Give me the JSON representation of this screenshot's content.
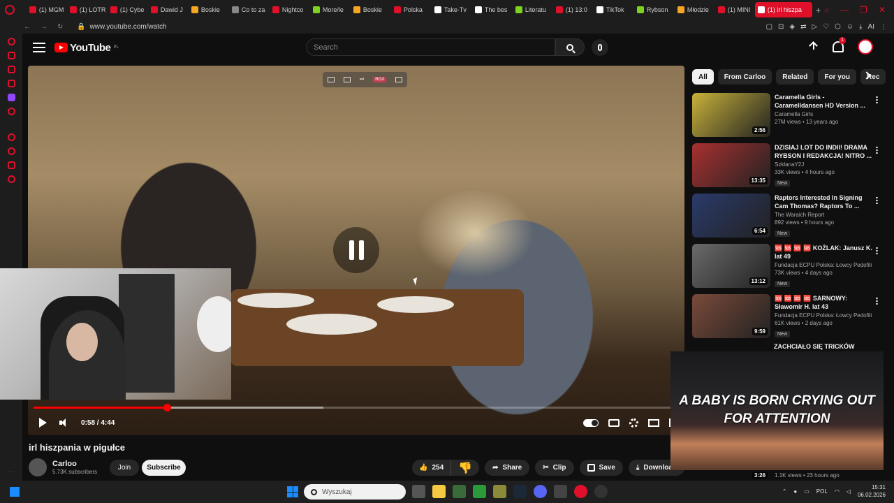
{
  "browser": {
    "tabs": [
      {
        "label": "(1) MGM",
        "color": "#e0102a"
      },
      {
        "label": "(1) LOTR",
        "color": "#e0102a"
      },
      {
        "label": "(1) Cybe",
        "color": "#e0102a"
      },
      {
        "label": "Dawid J",
        "color": "#e0102a"
      },
      {
        "label": "Boskie",
        "color": "#f5a623"
      },
      {
        "label": "Co to za",
        "color": "#888888"
      },
      {
        "label": "Nightco",
        "color": "#e0102a"
      },
      {
        "label": "More/le",
        "color": "#7ed321"
      },
      {
        "label": "Boskie",
        "color": "#f5a623"
      },
      {
        "label": "Polska",
        "color": "#e0102a"
      },
      {
        "label": "Take-Tv",
        "color": "#ffffff"
      },
      {
        "label": "The bes",
        "color": "#ffffff"
      },
      {
        "label": "Literatu",
        "color": "#7ed321"
      },
      {
        "label": "(1) 13:0",
        "color": "#e0102a"
      },
      {
        "label": "TikTok",
        "color": "#ffffff"
      },
      {
        "label": "Rybson",
        "color": "#7ed321"
      },
      {
        "label": "Młodzie",
        "color": "#f5a623"
      },
      {
        "label": "(1) MINI",
        "color": "#e0102a"
      }
    ],
    "active_tab": "(1) irl hiszpa",
    "new_tab": "+",
    "url": "www.youtube.com/watch"
  },
  "youtube": {
    "logo_text": "YouTube",
    "logo_region": "PL",
    "search_placeholder": "Search",
    "notification_count": "1"
  },
  "player": {
    "current_time": "0:58",
    "duration": "4:44",
    "time_display": "0:58 / 4:44",
    "played_fraction": 0.207,
    "loaded_fraction": 0.45,
    "overlay_label": "RGX"
  },
  "video": {
    "title": "irl hiszpania w pigułce",
    "channel_name": "Carloo",
    "subscribers": "5.73K subscribers",
    "join_label": "Join",
    "subscribe_label": "Subscribe",
    "likes": "254",
    "share_label": "Share",
    "clip_label": "Clip",
    "save_label": "Save",
    "download_label": "Download"
  },
  "filters": [
    "All",
    "From Carloo",
    "Related",
    "For you",
    "Rec"
  ],
  "recommendations": [
    {
      "title": "Caramella Girls - Caramelldansen HD Version ...",
      "channel": "Caramella Girls",
      "meta": "27M views • 13 years ago",
      "duration": "2:56",
      "new": "",
      "thumb_color": "#c8b23a"
    },
    {
      "title": "DZISIAJ LOT DO INDII! DRAMA RYBSON I REDAKCJA! NITRO ...",
      "channel": "SzklanaY2J",
      "meta": "33K views • 4 hours ago",
      "duration": "13:35",
      "new": "New",
      "thumb_color": "#a83030"
    },
    {
      "title": "Raptors Interested In Signing Cam Thomas? Raptors To ...",
      "channel": "The Waraich Report",
      "meta": "892 views • 9 hours ago",
      "duration": "6:54",
      "new": "New",
      "thumb_color": "#2a3a6a"
    },
    {
      "title": "🆘 🆘 🆘 🆘 KOŻLAK: Janusz K. lat 49",
      "channel": "Fundacja ECPU Polska: Łowcy Pedofili",
      "meta": "73K views • 4 days ago",
      "duration": "13:12",
      "new": "New",
      "thumb_color": "#6a6a6a"
    },
    {
      "title": "🆘 🆘 🆘 🆘 SARNOWY: Sławomir H. lat 43",
      "channel": "Fundacja ECPU Polska: Łowcy Pedofili",
      "meta": "61K views • 2 days ago",
      "duration": "9:59",
      "new": "New",
      "thumb_color": "#7a4a3a"
    }
  ],
  "partial_rec_title": "ZACHCIAŁO SIĘ TRICKÓW",
  "miniplayer": {
    "caption": "A BABY IS BORN CRYING OUT FOR ATTENTION"
  },
  "last_rec": {
    "duration": "3:26",
    "meta": "1.1K views • 23 hours ago"
  },
  "taskbar": {
    "search_placeholder": "Wyszukaj",
    "language": "POL",
    "time": "15:31",
    "date": "06.02.2026"
  }
}
